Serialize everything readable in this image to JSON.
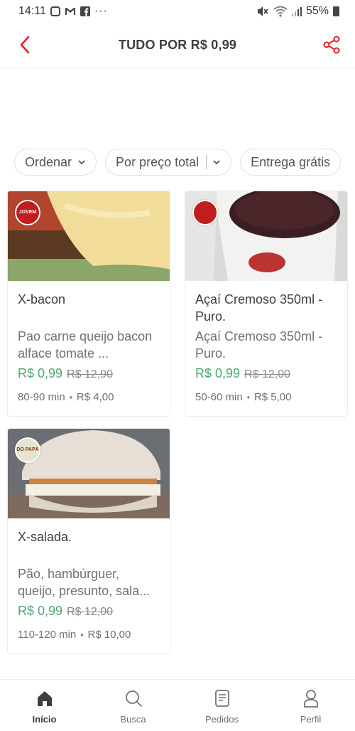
{
  "status_bar": {
    "time": "14:11",
    "battery": "55%"
  },
  "header": {
    "title": "TUDO POR R$ 0,99"
  },
  "filters": [
    {
      "label": "Ordenar"
    },
    {
      "label": "Por preço total"
    },
    {
      "label": "Entrega grátis"
    }
  ],
  "products": [
    {
      "title": "X-bacon",
      "description": "Pao carne queijo bacon alface tomate ...",
      "price": "R$ 0,99",
      "old_price": "R$ 12,90",
      "time": "80-90 min",
      "delivery": "R$ 4,00",
      "logo_text": "JOVEM"
    },
    {
      "title": "Açaí Cremoso 350ml - Puro.",
      "description": "Açaí Cremoso 350ml - Puro.",
      "price": "R$ 0,99",
      "old_price": "R$ 12,00",
      "time": "50-60 min",
      "delivery": "R$ 5,00",
      "logo_text": ""
    },
    {
      "title": "X-salada.",
      "description": "Pão, hambúrguer, queijo, presunto, sala...",
      "price": "R$ 0,99",
      "old_price": "R$ 12,00",
      "time": "110-120 min",
      "delivery": "R$ 10,00",
      "logo_text": "DO PAPÁ"
    }
  ],
  "bottom_nav": [
    {
      "label": "Início",
      "icon": "home-icon",
      "active": true
    },
    {
      "label": "Busca",
      "icon": "search-icon",
      "active": false
    },
    {
      "label": "Pedidos",
      "icon": "orders-icon",
      "active": false
    },
    {
      "label": "Perfil",
      "icon": "profile-icon",
      "active": false
    }
  ],
  "colors": {
    "accent": "#ea1d2c",
    "price_green": "#50a773",
    "text_dark": "#3e3e3e",
    "text_muted": "#717171"
  }
}
